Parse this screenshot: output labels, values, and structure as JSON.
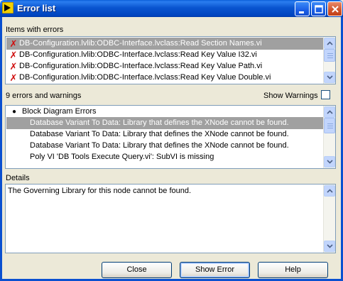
{
  "window": {
    "title": "Error list"
  },
  "items_section": {
    "label": "Items with errors",
    "items": [
      {
        "label": "DB-Configuration.lvlib:ODBC-Interface.lvclass:Read Section Names.vi",
        "selected": true
      },
      {
        "label": "DB-Configuration.lvlib:ODBC-Interface.lvclass:Read Key Value I32.vi",
        "selected": false
      },
      {
        "label": "DB-Configuration.lvlib:ODBC-Interface.lvclass:Read Key Value Path.vi",
        "selected": false
      },
      {
        "label": "DB-Configuration.lvlib:ODBC-Interface.lvclass:Read Key Value Double.vi",
        "selected": false
      }
    ]
  },
  "errors_section": {
    "count_label": "9 errors and warnings",
    "show_warnings_label": "Show Warnings",
    "show_warnings_checked": false,
    "category": "Block Diagram Errors",
    "items": [
      {
        "label": "Database Variant To Data: Library that defines the XNode cannot be found.",
        "selected": true
      },
      {
        "label": "Database Variant To Data: Library that defines the XNode cannot be found.",
        "selected": false
      },
      {
        "label": "Database Variant To Data: Library that defines the XNode cannot be found.",
        "selected": false
      },
      {
        "label": "Poly VI 'DB Tools Execute Query.vi': SubVI is missing",
        "selected": false
      }
    ]
  },
  "details_section": {
    "label": "Details",
    "text": "The Governing Library for this node cannot be found."
  },
  "buttons": {
    "close": "Close",
    "show_error": "Show Error",
    "help": "Help"
  },
  "colors": {
    "error_x": "#d01010",
    "selection": "#a0a0a0",
    "titlebar": "#0a55d0"
  }
}
